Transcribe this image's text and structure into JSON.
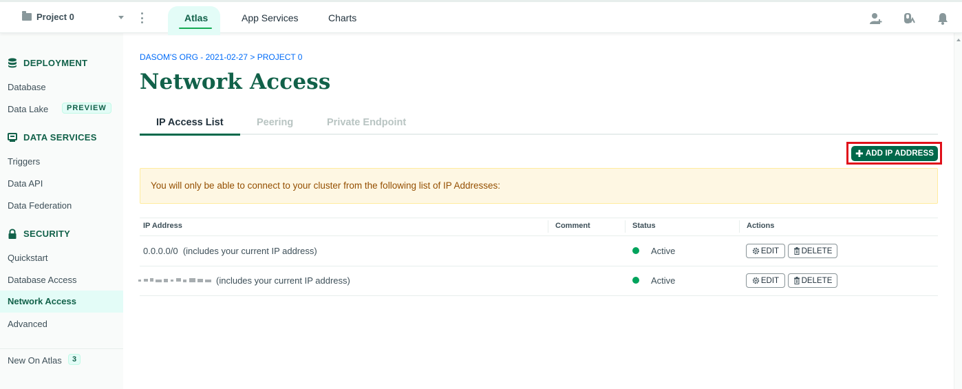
{
  "header": {
    "project_name": "Project 0",
    "tabs": [
      {
        "label": "Atlas",
        "active": true
      },
      {
        "label": "App Services",
        "active": false
      },
      {
        "label": "Charts",
        "active": false
      }
    ],
    "icons": [
      "user-plus-icon",
      "support-icon",
      "bell-icon"
    ]
  },
  "sidebar": {
    "sections": [
      {
        "title": "DEPLOYMENT",
        "icon": "database-icon"
      },
      {
        "title": "DATA SERVICES",
        "icon": "server-icon"
      },
      {
        "title": "SECURITY",
        "icon": "lock-icon"
      }
    ],
    "items": [
      {
        "label": "Database"
      },
      {
        "label": "Data Lake",
        "badge": "PREVIEW"
      },
      {
        "label": "Triggers"
      },
      {
        "label": "Data API"
      },
      {
        "label": "Data Federation"
      },
      {
        "label": "Quickstart"
      },
      {
        "label": "Database Access"
      },
      {
        "label": "Network Access",
        "active": true
      },
      {
        "label": "Advanced"
      }
    ],
    "footer": {
      "label": "New On Atlas",
      "count": "3"
    }
  },
  "main": {
    "breadcrumb": "DASOM'S ORG - 2021-02-27 > PROJECT 0",
    "title": "Network Access",
    "tabs": [
      {
        "label": "IP Access List",
        "active": true
      },
      {
        "label": "Peering",
        "active": false
      },
      {
        "label": "Private Endpoint",
        "active": false
      }
    ],
    "add_button": "ADD IP ADDRESS",
    "banner": "You will only be able to connect to your cluster from the following list of IP Addresses:",
    "table": {
      "columns": [
        "IP Address",
        "Comment",
        "Status",
        "Actions"
      ],
      "rows": [
        {
          "ip": "0.0.0.0/0",
          "note": "(includes your current IP address)",
          "comment": "",
          "status": "Active",
          "edit": "EDIT",
          "delete": "DELETE"
        },
        {
          "ip": "",
          "note": "(includes your current IP address)",
          "comment": "",
          "status": "Active",
          "edit": "EDIT",
          "delete": "DELETE"
        }
      ]
    }
  },
  "colors": {
    "brand_green": "#00684a",
    "dark_green": "#116149",
    "status_active": "#00a35c",
    "highlight_red": "#e0101a",
    "banner_bg": "#fef7e3",
    "link_blue": "#016bf8"
  }
}
